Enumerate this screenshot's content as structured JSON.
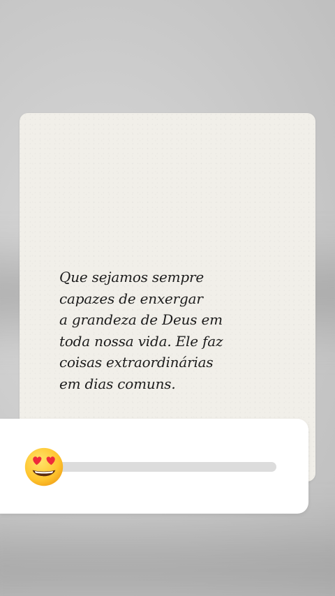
{
  "story": {
    "quote_text": "Que sejamos sempre\ncapazes de enxergar\na grandeza de Deus em\ntoda nossa vida. Ele faz\ncoisas extraordinárias\nem dias comuns."
  },
  "slider": {
    "emoji": "heart-eyes-emoji",
    "value": 0,
    "track_color": "#dcdcdc"
  },
  "colors": {
    "card_background": "#f1efe9",
    "text": "#1c1c1c",
    "sticker_background": "#ffffff"
  }
}
